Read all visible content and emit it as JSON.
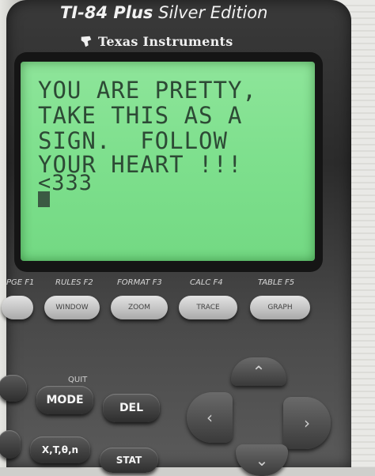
{
  "calculator": {
    "model_label": "TI-84 Plus",
    "edition_label": "Silver Edition",
    "maker_label": "Texas Instruments"
  },
  "screen": {
    "lines": [
      "YOU ARE PRETTY,",
      "TAKE THIS AS A",
      "SIGN.  FOLLOW",
      "YOUR HEART !!!",
      "<333"
    ]
  },
  "function_keys": {
    "labels": [
      "PGE F1",
      "RULES F2",
      "FORMAT F3",
      "CALC F4",
      "TABLE F5"
    ],
    "keys": [
      "WINDOW",
      "ZOOM",
      "TRACE",
      "GRAPH"
    ]
  },
  "keys": {
    "quit_label": "QUIT",
    "mode": "MODE",
    "del": "DEL",
    "xton": "X,T,θ,n",
    "stat": "STAT"
  }
}
